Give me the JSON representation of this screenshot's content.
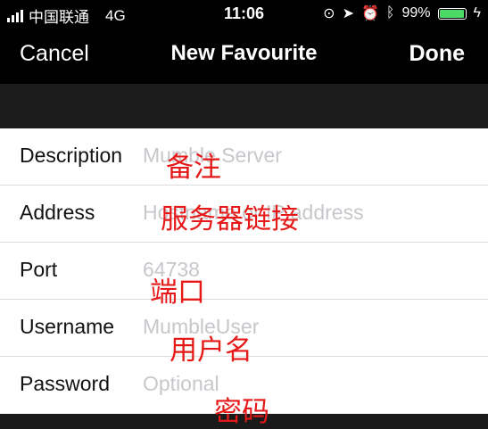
{
  "status_bar": {
    "carrier": "中国联通",
    "network": "4G",
    "time": "11:06",
    "battery": "99%",
    "battery_level": 0.99
  },
  "nav": {
    "cancel_label": "Cancel",
    "title": "New Favourite",
    "done_label": "Done"
  },
  "form": {
    "rows": [
      {
        "label": "Description",
        "placeholder": "Mumble Server"
      },
      {
        "label": "Address",
        "placeholder": "Hostname or IP address"
      },
      {
        "label": "Port",
        "placeholder": "64738"
      },
      {
        "label": "Username",
        "placeholder": "MumbleUser"
      },
      {
        "label": "Password",
        "placeholder": "Optional"
      }
    ]
  },
  "annotations": [
    "备注",
    "服务器链接",
    "端口",
    "用户名",
    "密码"
  ],
  "colors": {
    "annotation": "#e61919",
    "battery": "#4cd964",
    "placeholder": "#c7c7cc"
  }
}
